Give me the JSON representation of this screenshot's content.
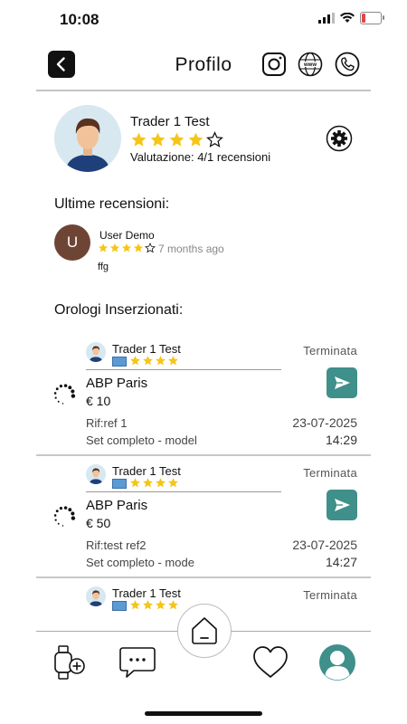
{
  "status_bar": {
    "time": "10:08",
    "battery": "9+"
  },
  "header": {
    "title": "Profilo"
  },
  "profile": {
    "name": "Trader 1  Test",
    "rating_stars": 4,
    "rating_text": "Valutazione: 4/1 recensioni"
  },
  "sections": {
    "reviews_title": "Ultime recensioni:",
    "listings_title": "Orologi Inserzionati:"
  },
  "review": {
    "avatar_letter": "U",
    "user": "User Demo",
    "stars": 4,
    "time": "7 months ago",
    "text": "ffg"
  },
  "listings": [
    {
      "seller": "Trader 1 Test",
      "status": "Terminata",
      "title": "ABP Paris",
      "price": "€ 10",
      "ref": "Rif:ref 1",
      "date": "23-07-2025",
      "desc": "Set completo - model",
      "time": "14:29"
    },
    {
      "seller": "Trader 1 Test",
      "status": "Terminata",
      "title": "ABP Paris",
      "price": "€ 50",
      "ref": "Rif:test ref2",
      "date": "23-07-2025",
      "desc": "Set completo - mode",
      "time": "14:27"
    },
    {
      "seller": "Trader 1 Test",
      "status": "Terminata"
    }
  ],
  "colors": {
    "accent": "#3f8f8a",
    "star": "#f5c518",
    "avatar_review": "#6e4535"
  },
  "icons": [
    "back-icon",
    "instagram-icon",
    "web-icon",
    "phone-icon",
    "gear-icon",
    "send-icon",
    "spinner-icon",
    "home-icon",
    "watch-add-icon",
    "chat-icon",
    "heart-icon",
    "profile-icon"
  ]
}
